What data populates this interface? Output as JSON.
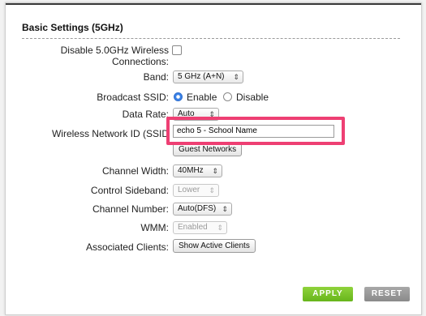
{
  "section": {
    "title": "Basic Settings (5GHz)"
  },
  "disable_wireless": {
    "label_line1": "Disable 5.0GHz Wireless",
    "label_line2": "Connections:",
    "checked": false
  },
  "band": {
    "label": "Band:",
    "value": "5 GHz (A+N)"
  },
  "broadcast_ssid": {
    "label": "Broadcast SSID:",
    "enable": "Enable",
    "disable": "Disable",
    "selected": "Enable"
  },
  "data_rate": {
    "label": "Data Rate:",
    "value": "Auto"
  },
  "network_id": {
    "label": "Wireless Network ID (SSID",
    "value": "echo 5 - School Name",
    "guest_button": "Guest Networks"
  },
  "channel_width": {
    "label": "Channel Width:",
    "value": "40MHz"
  },
  "control_sideband": {
    "label": "Control Sideband:",
    "value": "Lower"
  },
  "channel_number": {
    "label": "Channel Number:",
    "value": "Auto(DFS)"
  },
  "wmm": {
    "label": "WMM:",
    "value": "Enabled"
  },
  "associated_clients": {
    "label": "Associated Clients:",
    "button": "Show Active Clients"
  },
  "actions": {
    "apply": "APPLY",
    "reset": "RESET"
  },
  "colors": {
    "highlight": "#ee3f73",
    "apply_bg": "#7cc42c",
    "reset_bg": "#999999",
    "radio_selected": "#3b82e6"
  }
}
